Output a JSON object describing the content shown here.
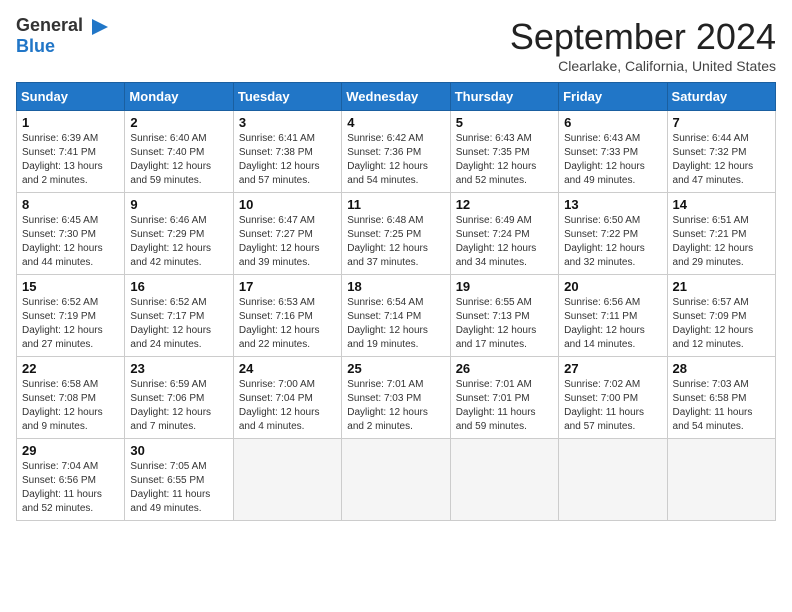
{
  "header": {
    "logo_general": "General",
    "logo_blue": "Blue",
    "month_title": "September 2024",
    "location": "Clearlake, California, United States"
  },
  "weekdays": [
    "Sunday",
    "Monday",
    "Tuesday",
    "Wednesday",
    "Thursday",
    "Friday",
    "Saturday"
  ],
  "weeks": [
    [
      {
        "day": "1",
        "sunrise": "6:39 AM",
        "sunset": "7:41 PM",
        "daylight": "13 hours and 2 minutes."
      },
      {
        "day": "2",
        "sunrise": "6:40 AM",
        "sunset": "7:40 PM",
        "daylight": "12 hours and 59 minutes."
      },
      {
        "day": "3",
        "sunrise": "6:41 AM",
        "sunset": "7:38 PM",
        "daylight": "12 hours and 57 minutes."
      },
      {
        "day": "4",
        "sunrise": "6:42 AM",
        "sunset": "7:36 PM",
        "daylight": "12 hours and 54 minutes."
      },
      {
        "day": "5",
        "sunrise": "6:43 AM",
        "sunset": "7:35 PM",
        "daylight": "12 hours and 52 minutes."
      },
      {
        "day": "6",
        "sunrise": "6:43 AM",
        "sunset": "7:33 PM",
        "daylight": "12 hours and 49 minutes."
      },
      {
        "day": "7",
        "sunrise": "6:44 AM",
        "sunset": "7:32 PM",
        "daylight": "12 hours and 47 minutes."
      }
    ],
    [
      {
        "day": "8",
        "sunrise": "6:45 AM",
        "sunset": "7:30 PM",
        "daylight": "12 hours and 44 minutes."
      },
      {
        "day": "9",
        "sunrise": "6:46 AM",
        "sunset": "7:29 PM",
        "daylight": "12 hours and 42 minutes."
      },
      {
        "day": "10",
        "sunrise": "6:47 AM",
        "sunset": "7:27 PM",
        "daylight": "12 hours and 39 minutes."
      },
      {
        "day": "11",
        "sunrise": "6:48 AM",
        "sunset": "7:25 PM",
        "daylight": "12 hours and 37 minutes."
      },
      {
        "day": "12",
        "sunrise": "6:49 AM",
        "sunset": "7:24 PM",
        "daylight": "12 hours and 34 minutes."
      },
      {
        "day": "13",
        "sunrise": "6:50 AM",
        "sunset": "7:22 PM",
        "daylight": "12 hours and 32 minutes."
      },
      {
        "day": "14",
        "sunrise": "6:51 AM",
        "sunset": "7:21 PM",
        "daylight": "12 hours and 29 minutes."
      }
    ],
    [
      {
        "day": "15",
        "sunrise": "6:52 AM",
        "sunset": "7:19 PM",
        "daylight": "12 hours and 27 minutes."
      },
      {
        "day": "16",
        "sunrise": "6:52 AM",
        "sunset": "7:17 PM",
        "daylight": "12 hours and 24 minutes."
      },
      {
        "day": "17",
        "sunrise": "6:53 AM",
        "sunset": "7:16 PM",
        "daylight": "12 hours and 22 minutes."
      },
      {
        "day": "18",
        "sunrise": "6:54 AM",
        "sunset": "7:14 PM",
        "daylight": "12 hours and 19 minutes."
      },
      {
        "day": "19",
        "sunrise": "6:55 AM",
        "sunset": "7:13 PM",
        "daylight": "12 hours and 17 minutes."
      },
      {
        "day": "20",
        "sunrise": "6:56 AM",
        "sunset": "7:11 PM",
        "daylight": "12 hours and 14 minutes."
      },
      {
        "day": "21",
        "sunrise": "6:57 AM",
        "sunset": "7:09 PM",
        "daylight": "12 hours and 12 minutes."
      }
    ],
    [
      {
        "day": "22",
        "sunrise": "6:58 AM",
        "sunset": "7:08 PM",
        "daylight": "12 hours and 9 minutes."
      },
      {
        "day": "23",
        "sunrise": "6:59 AM",
        "sunset": "7:06 PM",
        "daylight": "12 hours and 7 minutes."
      },
      {
        "day": "24",
        "sunrise": "7:00 AM",
        "sunset": "7:04 PM",
        "daylight": "12 hours and 4 minutes."
      },
      {
        "day": "25",
        "sunrise": "7:01 AM",
        "sunset": "7:03 PM",
        "daylight": "12 hours and 2 minutes."
      },
      {
        "day": "26",
        "sunrise": "7:01 AM",
        "sunset": "7:01 PM",
        "daylight": "11 hours and 59 minutes."
      },
      {
        "day": "27",
        "sunrise": "7:02 AM",
        "sunset": "7:00 PM",
        "daylight": "11 hours and 57 minutes."
      },
      {
        "day": "28",
        "sunrise": "7:03 AM",
        "sunset": "6:58 PM",
        "daylight": "11 hours and 54 minutes."
      }
    ],
    [
      {
        "day": "29",
        "sunrise": "7:04 AM",
        "sunset": "6:56 PM",
        "daylight": "11 hours and 52 minutes."
      },
      {
        "day": "30",
        "sunrise": "7:05 AM",
        "sunset": "6:55 PM",
        "daylight": "11 hours and 49 minutes."
      },
      null,
      null,
      null,
      null,
      null
    ]
  ]
}
